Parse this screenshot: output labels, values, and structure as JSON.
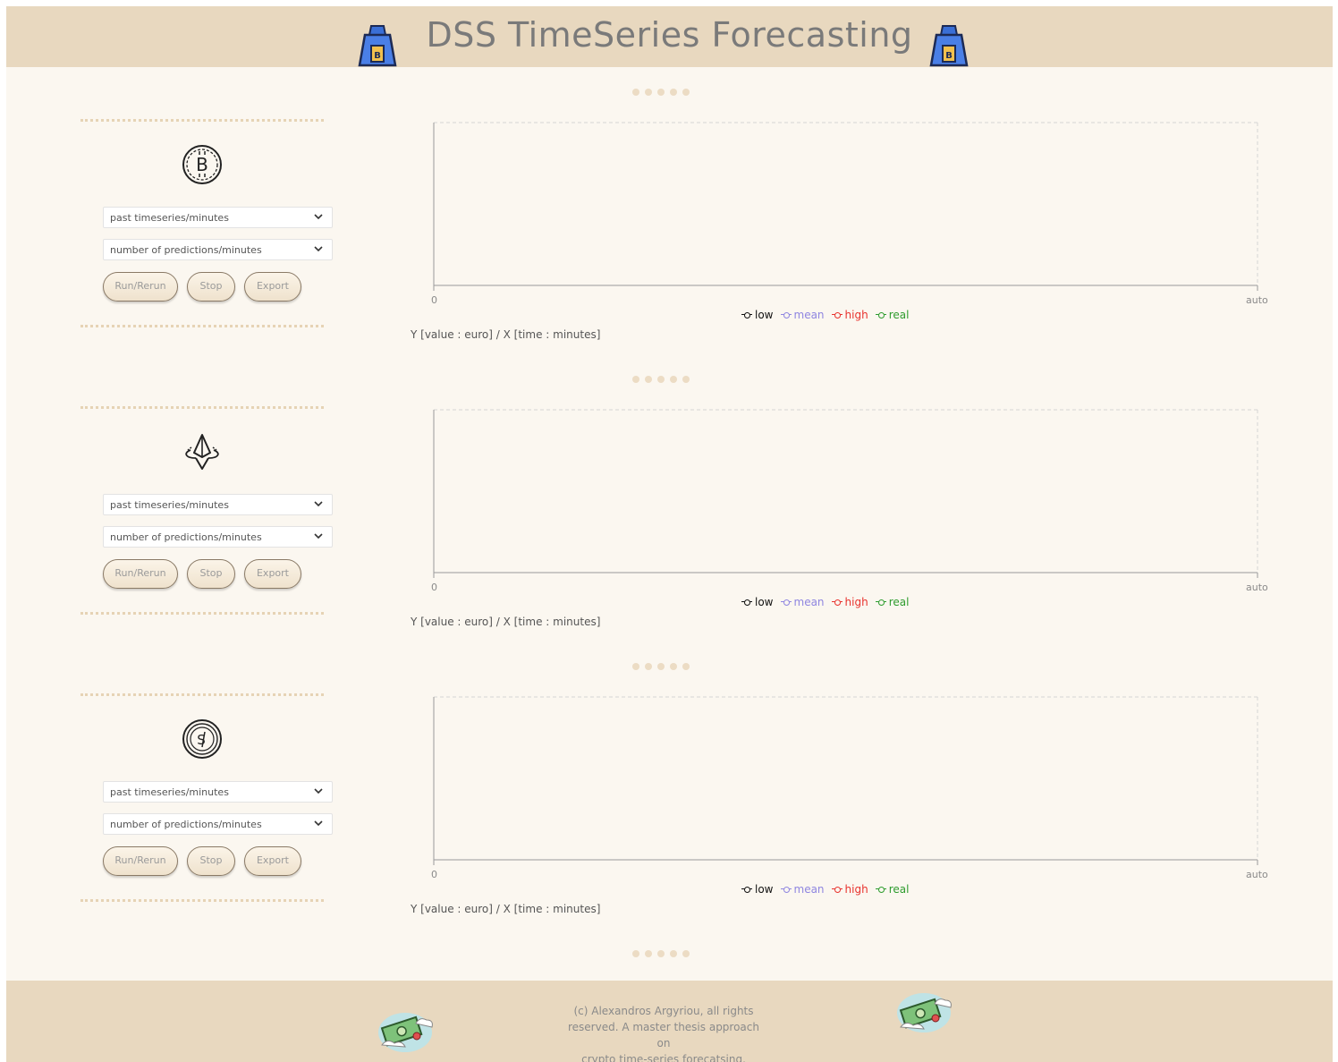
{
  "header": {
    "title": "DSS TimeSeries Forecasting"
  },
  "panels": [
    {
      "coin": "bitcoin-coin-icon",
      "past_select": "past timeseries/minutes",
      "pred_select": "number of predictions/minutes",
      "run_label": "Run/Rerun",
      "stop_label": "Stop",
      "export_label": "Export"
    },
    {
      "coin": "ethereum-coin-icon",
      "past_select": "past timeseries/minutes",
      "pred_select": "number of predictions/minutes",
      "run_label": "Run/Rerun",
      "stop_label": "Stop",
      "export_label": "Export"
    },
    {
      "coin": "sol-coin-icon",
      "past_select": "past timeseries/minutes",
      "pred_select": "number of predictions/minutes",
      "run_label": "Run/Rerun",
      "stop_label": "Stop",
      "export_label": "Export"
    }
  ],
  "charts": [
    {
      "x_min": "0",
      "x_max": "auto",
      "axis_label": "Y [value : euro] / X [time : minutes]",
      "legend": [
        {
          "name": "low",
          "color": "#111111"
        },
        {
          "name": "mean",
          "color": "#8f86e0"
        },
        {
          "name": "high",
          "color": "#e8332e"
        },
        {
          "name": "real",
          "color": "#2e9c2e"
        }
      ]
    },
    {
      "x_min": "0",
      "x_max": "auto",
      "axis_label": "Y [value : euro] / X [time : minutes]",
      "legend": [
        {
          "name": "low",
          "color": "#111111"
        },
        {
          "name": "mean",
          "color": "#8f86e0"
        },
        {
          "name": "high",
          "color": "#e8332e"
        },
        {
          "name": "real",
          "color": "#2e9c2e"
        }
      ]
    },
    {
      "x_min": "0",
      "x_max": "auto",
      "axis_label": "Y [value : euro] / X [time : minutes]",
      "legend": [
        {
          "name": "low",
          "color": "#111111"
        },
        {
          "name": "mean",
          "color": "#8f86e0"
        },
        {
          "name": "high",
          "color": "#e8332e"
        },
        {
          "name": "real",
          "color": "#2e9c2e"
        }
      ]
    }
  ],
  "footer": {
    "text_line1": "(c) Alexandros Argyriou, all rights",
    "text_line2": "reserved. A master thesis approach on",
    "text_line3": "crypto time-series forecatsing."
  },
  "chart_data": [
    {
      "type": "line",
      "x": [],
      "series": [
        {
          "name": "low",
          "values": []
        },
        {
          "name": "mean",
          "values": []
        },
        {
          "name": "high",
          "values": []
        },
        {
          "name": "real",
          "values": []
        }
      ],
      "xlabel": "Y [value : euro] / X [time : minutes]",
      "x_tick_labels": [
        "0",
        "auto"
      ],
      "grid": false,
      "legend": "bottom"
    },
    {
      "type": "line",
      "x": [],
      "series": [
        {
          "name": "low",
          "values": []
        },
        {
          "name": "mean",
          "values": []
        },
        {
          "name": "high",
          "values": []
        },
        {
          "name": "real",
          "values": []
        }
      ],
      "xlabel": "Y [value : euro] / X [time : minutes]",
      "x_tick_labels": [
        "0",
        "auto"
      ],
      "grid": false,
      "legend": "bottom"
    },
    {
      "type": "line",
      "x": [],
      "series": [
        {
          "name": "low",
          "values": []
        },
        {
          "name": "mean",
          "values": []
        },
        {
          "name": "high",
          "values": []
        },
        {
          "name": "real",
          "values": []
        }
      ],
      "xlabel": "Y [value : euro] / X [time : minutes]",
      "x_tick_labels": [
        "0",
        "auto"
      ],
      "grid": false,
      "legend": "bottom"
    }
  ]
}
